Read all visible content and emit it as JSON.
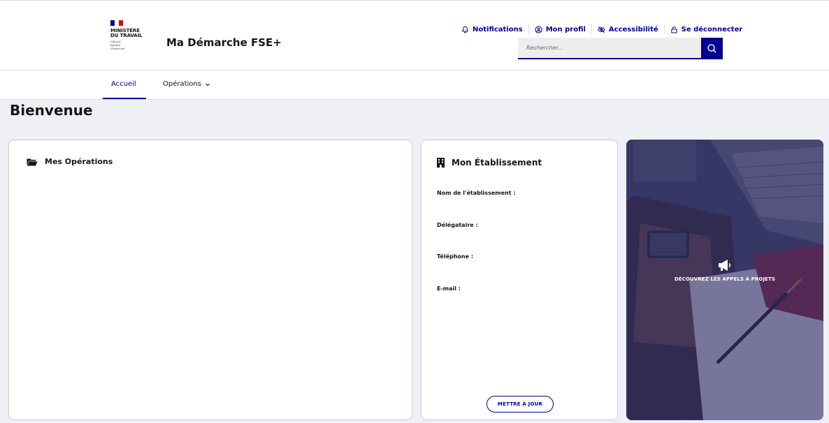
{
  "brand": {
    "ministry_line1": "MINISTÈRE",
    "ministry_line2": "DU TRAVAIL",
    "motto": "Liberté\nÉgalité\nFraternité",
    "app_title": "Ma Démarche FSE+"
  },
  "top_links": {
    "notifications": "Notifications",
    "profile": "Mon profil",
    "accessibility": "Accessibilité",
    "logout": "Se déconnecter"
  },
  "search": {
    "placeholder": "Rechercher..."
  },
  "nav": {
    "home": "Accueil",
    "operations": "Opérations"
  },
  "page": {
    "title": "Bienvenue"
  },
  "operations_card": {
    "title": "Mes Opérations"
  },
  "establishment_card": {
    "title": "Mon Établissement",
    "name_label": "Nom de l'établissement :",
    "delegate_label": "Délégataire :",
    "phone_label": "Téléphone :",
    "email_label": "E-mail :",
    "update_button": "METTRE À JOUR"
  },
  "promo": {
    "cta": "DÉCOUVREZ LES APPELS À PROJETS"
  },
  "colors": {
    "primary": "#000091",
    "background": "#eef0f6"
  }
}
